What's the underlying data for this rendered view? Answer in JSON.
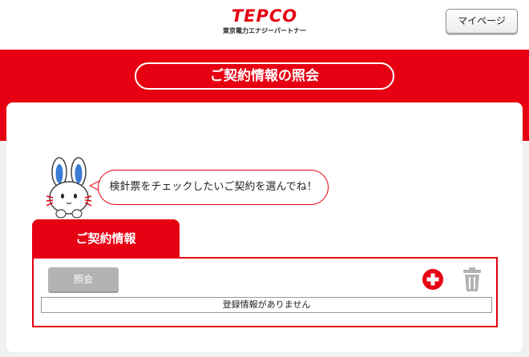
{
  "header": {
    "logo_text": "TEPCO",
    "logo_subtext": "東京電力エナジーパートナー",
    "mypage_label": "マイページ"
  },
  "page": {
    "title": "ご契約情報の照会"
  },
  "mascot": {
    "message": "検針票をチェックしたいご契約を選んでね！"
  },
  "contract_section": {
    "tab_label": "ご契約情報",
    "inquiry_button_label": "照会",
    "empty_message": "登録情報がありません"
  },
  "colors": {
    "brand_red": "#e60012",
    "disabled_gray": "#b3b3b3",
    "background": "#f0f0f0"
  },
  "icons": {
    "add": "plus-circle-icon",
    "delete": "trash-icon"
  }
}
